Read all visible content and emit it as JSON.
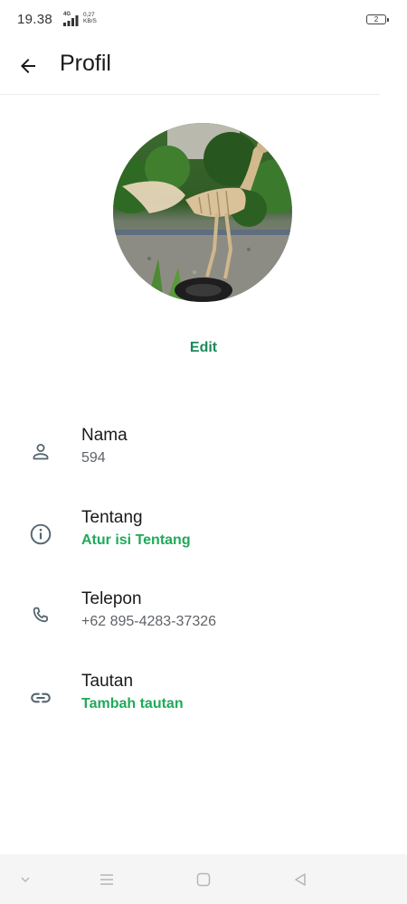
{
  "status_bar": {
    "time": "19.38",
    "network_type": "4G",
    "speed_value": "0,27",
    "speed_unit": "KB/S",
    "battery": "2"
  },
  "header": {
    "title": "Profil",
    "back_icon": "arrow-left-icon"
  },
  "profile": {
    "edit_label": "Edit"
  },
  "rows": [
    {
      "icon": "person-icon",
      "label": "Nama",
      "value": "594"
    },
    {
      "icon": "info-icon",
      "label": "Tentang",
      "value": "Atur isi Tentang"
    },
    {
      "icon": "phone-icon",
      "label": "Telepon",
      "value": "+62 895-4283-37326"
    },
    {
      "icon": "link-icon",
      "label": "Tautan",
      "value": "Tambah tautan"
    }
  ],
  "colors": {
    "accent": "#1faa59",
    "edit_accent": "#1b8a5a",
    "icon_gray": "#54656f"
  },
  "nav_bar": {
    "icons": [
      "chevron-down-icon",
      "menu-icon",
      "home-square-icon",
      "back-triangle-icon"
    ]
  }
}
